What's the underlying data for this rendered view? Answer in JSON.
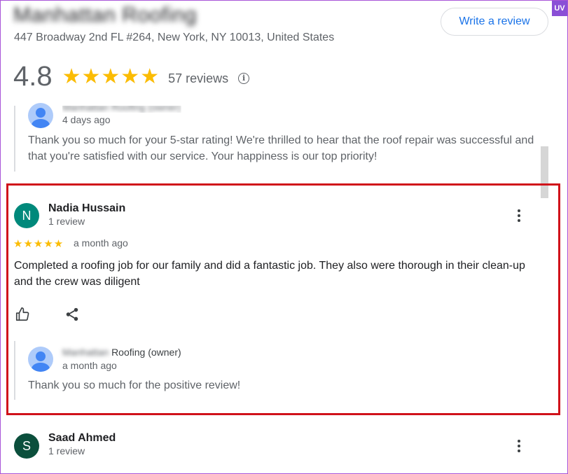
{
  "business": {
    "name": "Manhattan Roofing",
    "address": "447 Broadway 2nd FL #264, New York, NY 10013, United States",
    "write_review_label": "Write a review",
    "rating": "4.8",
    "stars": "★★★★★",
    "review_count": "57 reviews",
    "badge": "UV"
  },
  "prev_reply": {
    "owner_name": "Manhattan Roofing (owner)",
    "time": "4 days ago",
    "text_line1": "Thank you so much for your 5-star rating! We're thrilled to hear that the roof repair was successful and",
    "text_line2": "that you're satisfied with our service. Your happiness is our top priority!"
  },
  "review1": {
    "initial": "N",
    "name": "Nadia Hussain",
    "reviews_count": "1 review",
    "stars": "★★★★★",
    "rating": 5,
    "time": "a month ago",
    "text_line1": "Completed a roofing job for our family and did a fantastic job. They also were thorough in their clean-up",
    "text_line2": "and the crew was diligent",
    "reply": {
      "owner_blurred": "Manhattan",
      "owner_suffix": "Roofing (owner)",
      "time": "a month ago",
      "text": "Thank you so much for the positive review!"
    }
  },
  "review2": {
    "initial": "S",
    "name": "Saad Ahmed",
    "reviews_count": "1 review"
  },
  "colors": {
    "star": "#fbbc04",
    "link": "#1a73e8",
    "highlight": "#d0121a",
    "avatar_n": "#00897b",
    "avatar_s": "#0b4f3c"
  }
}
